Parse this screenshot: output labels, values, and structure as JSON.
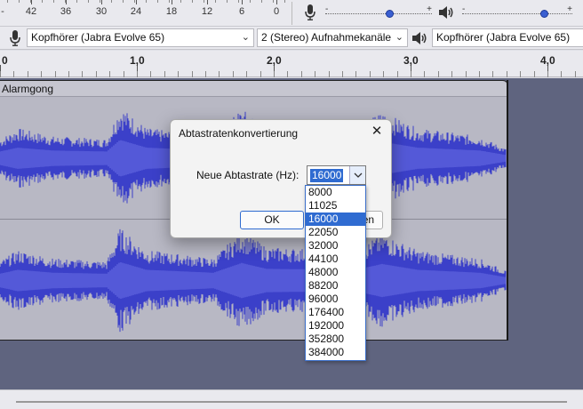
{
  "meter": {
    "ticks": [
      "42",
      "36",
      "30",
      "24",
      "18",
      "12",
      "6",
      "0"
    ],
    "first_partial": "-",
    "plus_label": "+",
    "minus_label": "-"
  },
  "devices": {
    "recording_device": "Kopfhörer (Jabra Evolve 65)",
    "recording_channels": "2 (Stereo) Aufnahmekanäle",
    "playback_device": "Kopfhörer (Jabra Evolve 65)"
  },
  "timeline": {
    "labels": [
      "0",
      "1,0",
      "2,0",
      "3,0",
      "4,0"
    ]
  },
  "track": {
    "name": "Alarmgong",
    "wave_color": "#3b40c9"
  },
  "dialog": {
    "title": "Abtastratenkonvertierung",
    "rate_label": "Neue Abtastrate (Hz):",
    "current_rate": "16000",
    "ok_label": "OK",
    "cancel_label": "Abbrechen",
    "rate_options": [
      "8000",
      "11025",
      "16000",
      "22050",
      "32000",
      "44100",
      "48000",
      "88200",
      "96000",
      "176400",
      "192000",
      "352800",
      "384000"
    ],
    "selected_index": 2
  },
  "colors": {
    "accent": "#2f6bd1",
    "track_background": "#b8b8c4",
    "workspace": "#5f647f"
  }
}
